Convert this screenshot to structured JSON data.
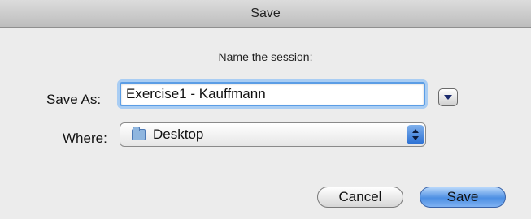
{
  "dialog": {
    "title": "Save",
    "instruction": "Name the session:",
    "save_as_label": "Save As:",
    "filename_value": "Exercise1 - Kauffmann",
    "where_label": "Where:",
    "where_value": "Desktop",
    "cancel_label": "Cancel",
    "save_label": "Save"
  },
  "icons": {
    "expand": "chevron-down-icon",
    "folder": "folder-icon",
    "popup": "updown-arrows-icon"
  },
  "colors": {
    "focus_ring": "#5b9de5",
    "default_button": "#4d8fe3"
  }
}
